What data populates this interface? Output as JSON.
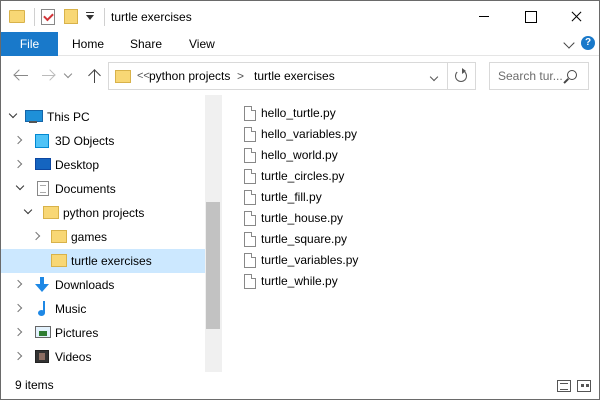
{
  "window": {
    "title": "turtle exercises"
  },
  "ribbon": {
    "tabs": [
      "File",
      "Home",
      "Share",
      "View"
    ]
  },
  "address": {
    "overflow": "<<",
    "crumbs": [
      "python projects",
      "turtle exercises"
    ],
    "separator": ">"
  },
  "search": {
    "placeholder": "Search tur..."
  },
  "nav_tree": [
    {
      "label": "This PC",
      "icon": "this-pc-icon",
      "level": 0,
      "expanded": true
    },
    {
      "label": "3D Objects",
      "icon": "3d-objects-icon",
      "level": 1,
      "expanded": false
    },
    {
      "label": "Desktop",
      "icon": "desktop-icon",
      "level": 1,
      "expanded": false
    },
    {
      "label": "Documents",
      "icon": "documents-icon",
      "level": 1,
      "expanded": true
    },
    {
      "label": "python projects",
      "icon": "folder-icon",
      "level": 2,
      "expanded": true
    },
    {
      "label": "games",
      "icon": "folder-icon",
      "level": 3,
      "expanded": false
    },
    {
      "label": "turtle exercises",
      "icon": "folder-icon",
      "level": 3,
      "selected": true
    },
    {
      "label": "Downloads",
      "icon": "downloads-icon",
      "level": 1,
      "expanded": false
    },
    {
      "label": "Music",
      "icon": "music-icon",
      "level": 1,
      "expanded": false
    },
    {
      "label": "Pictures",
      "icon": "pictures-icon",
      "level": 1,
      "expanded": false
    },
    {
      "label": "Videos",
      "icon": "videos-icon",
      "level": 1,
      "expanded": false
    }
  ],
  "files": [
    "hello_turtle.py",
    "hello_variables.py",
    "hello_world.py",
    "turtle_circles.py",
    "turtle_fill.py",
    "turtle_house.py",
    "turtle_square.py",
    "turtle_variables.py",
    "turtle_while.py"
  ],
  "status": {
    "item_count": "9 items"
  },
  "colors": {
    "accent": "#1979ca",
    "selection": "#cce8ff",
    "folder": "#f8d775"
  }
}
